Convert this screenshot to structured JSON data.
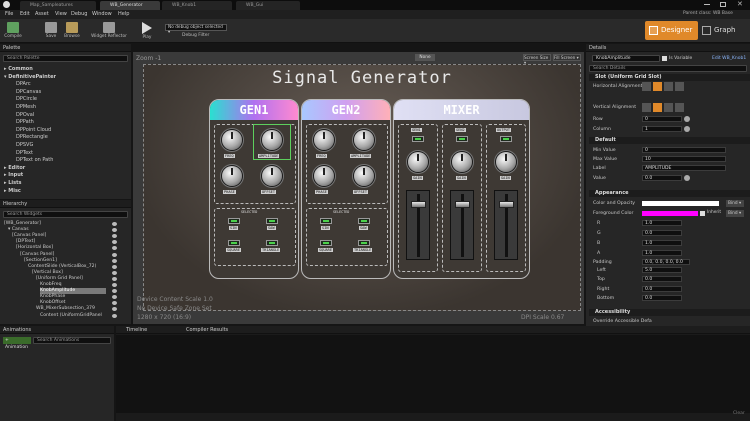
{
  "window": {
    "tabs": [
      "Map_Sampleatures",
      "WB_Generator",
      "WB_Knob1",
      "WB_Gui"
    ],
    "parent_class": "Parent class: WB Base"
  },
  "menu": [
    "File",
    "Edit",
    "Asset",
    "View",
    "Debug",
    "Window",
    "Help"
  ],
  "toolbar": {
    "compile": "Compile",
    "save": "Save",
    "browse": "Browse",
    "widget_reflector": "Widget Reflector",
    "play": "Play",
    "debug_object": "No debug object selected ▾",
    "debug_filter": "Debug Filter",
    "designer": "Designer",
    "graph": "Graph"
  },
  "palette": {
    "title": "Palette",
    "search_placeholder": "Search Palette",
    "items": [
      "▸ Common",
      "▾ DefinitivePainter",
      "DPArc",
      "DPCanvas",
      "DPCircle",
      "DPMesh",
      "DPOval",
      "DPPath",
      "DPPoint Cloud",
      "DPRectangle",
      "DPSVG",
      "DPText",
      "DPText on Path",
      "▸ Editor",
      "▸ Input",
      "▸ Lists",
      "▸ Misc"
    ]
  },
  "hierarchy": {
    "title": "Hierarchy",
    "search_placeholder": "Search Widgets",
    "items": [
      "[WB_Generator]",
      "▾ Canvas",
      "[Canvas Panel]",
      "[DPText]",
      "[Horizontal Box]",
      "[Canvas Panel]",
      "[SectionGen1]",
      "ContentSlide (VerticalBox_72)",
      "[Vertical Box]",
      "[Uniform Grid Panel]",
      "KnobFreq",
      "KnobAmplitude",
      "KnobPhase",
      "KnobOffset",
      "WB_MixerSubsection_379",
      "Content (UniformGridPanel"
    ]
  },
  "canvas": {
    "zoom": "Zoom -1",
    "title": "Signal Generator",
    "none_btn": "None",
    "screen_size": "Screen Size ▾",
    "fill_screen": "Fill Screen ▾",
    "device_scale": "Device Content Scale 1.0",
    "safe_zone": "No Device Safe Zone Set",
    "resolution": "1280 x 720 (16:9)",
    "dpi": "DPI Scale 0.67",
    "gen1": {
      "title": "GEN1",
      "knob_labels": [
        "FREQ",
        "AMPLITUDE",
        "PHASE",
        "OFFSET"
      ],
      "select_label": "SELECTED",
      "waves": [
        "SIN",
        "SAW",
        "SQUARE",
        "TRIANGLE"
      ]
    },
    "gen2": {
      "title": "GEN2",
      "knob_labels": [
        "FREQ",
        "AMPLITUDE",
        "PHASE",
        "OFFSET"
      ],
      "select_label": "SELECTED",
      "waves": [
        "SIN",
        "SAW",
        "SQUARE",
        "TRIANGLE"
      ]
    },
    "mixer": {
      "title": "MIXER",
      "cols": [
        "GEN1",
        "GEN2",
        "OUTPUT"
      ],
      "gain": "GAIN"
    }
  },
  "bottom": {
    "animations_tab": "Animations",
    "add_animation": "+ Animation",
    "search_animations": "Search Animations",
    "timeline_tab": "Timeline",
    "compiler_tab": "Compiler Results",
    "clear": "Clear"
  },
  "details": {
    "title": "Details",
    "name_value": "KnobAmplitude",
    "is_variable": "Is Variable",
    "edit_link": "Edit WB_Knob1",
    "search_placeholder": "Search Details",
    "slot_section": "Slot (Uniform Grid Slot)",
    "horizontal_alignment": "Horizontal Alignment",
    "vertical_alignment": "Vertical Alignment",
    "row": "Row",
    "row_value": "0",
    "column": "Column",
    "column_value": "1",
    "default_section": "Default",
    "min_value": "Min Value",
    "min_value_v": "0",
    "max_value": "Max Value",
    "max_value_v": "10",
    "label": "Label",
    "label_v": "AMPLITUDE",
    "value": "Value",
    "value_v": "0.0",
    "appearance_section": "Appearance",
    "color_opacity": "Color and Opacity",
    "foreground_color": "Foreground Color",
    "bind": "Bind ▾",
    "inherit": "Inherit",
    "r": "R",
    "r_v": "1.0",
    "g": "G",
    "g_v": "0.0",
    "b": "B",
    "b_v": "1.0",
    "a": "A",
    "a_v": "1.0",
    "padding": "Padding",
    "padding_v": "0.0, 0.0, 0.0, 0.0",
    "left": "Left",
    "left_v": "5.0",
    "top": "Top",
    "top_v": "0.0",
    "right": "Right",
    "right_v": "0.0",
    "bottom": "Bottom",
    "bottom_v": "0.0",
    "accessibility_section": "Accessibility",
    "override_accessible": "Override Accessible Defa"
  },
  "colors": {
    "accent_orange": "#e0892a",
    "fg_swatch": "#ff00ff",
    "gen1_grad": "#29e0d0",
    "gen2_grad": "#c8a0f0",
    "mixer_head": "#d8d8f0"
  }
}
